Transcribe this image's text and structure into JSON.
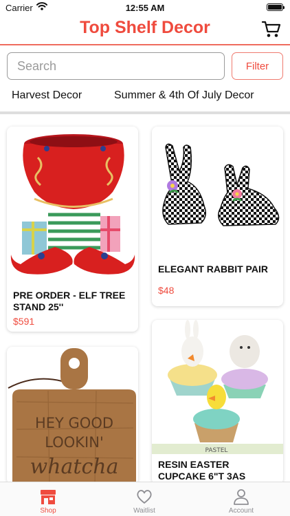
{
  "status_bar": {
    "carrier": "Carrier",
    "time": "12:55 AM"
  },
  "header": {
    "title": "Top Shelf Decor",
    "cart_icon": "cart-icon"
  },
  "search": {
    "placeholder": "Search",
    "value": ""
  },
  "filter": {
    "label": "Filter"
  },
  "categories": [
    "Harvest Decor",
    "Summer & 4th Of July Decor"
  ],
  "products": [
    {
      "name": "PRE ORDER - ELF TREE STAND 25''",
      "price": "$591"
    },
    {
      "name": "ELEGANT RABBIT PAIR",
      "price": "$48"
    },
    {
      "name": "",
      "price": ""
    },
    {
      "name": "RESIN EASTER CUPCAKE 6\"T 3AS",
      "price": ""
    }
  ],
  "product_image_text": {
    "cutting_board_line1": "HEY GOOD",
    "cutting_board_line2": "LOOKIN'",
    "cutting_board_line3": "whatcha",
    "cupcake_tag": "PASTEL"
  },
  "tabs": [
    {
      "label": "Shop",
      "icon": "shop-icon",
      "active": true
    },
    {
      "label": "Waitlist",
      "icon": "heart-icon",
      "active": false
    },
    {
      "label": "Account",
      "icon": "person-icon",
      "active": false
    }
  ],
  "colors": {
    "accent": "#ef4b3e",
    "inactive": "#8e8e93",
    "divider": "#dedede"
  }
}
